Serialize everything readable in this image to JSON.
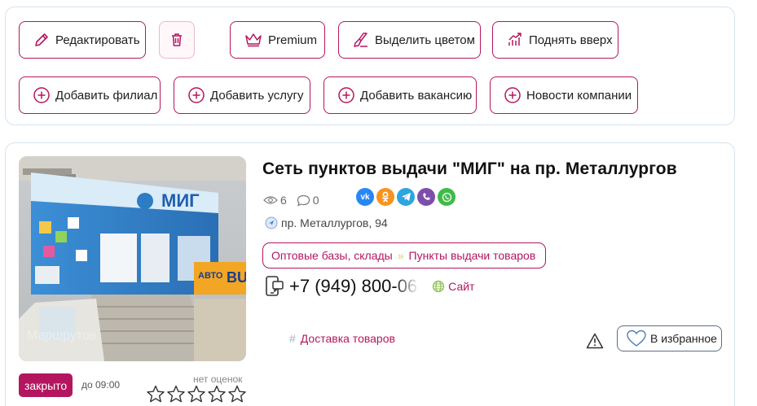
{
  "actions": {
    "edit": "Редактировать",
    "premium": "Premium",
    "highlight": "Выделить цветом",
    "raise": "Поднять вверх",
    "add_branch": "Добавить филиал",
    "add_service": "Добавить услугу",
    "add_vacancy": "Добавить вакансию",
    "company_news": "Новости компании"
  },
  "listing": {
    "title": "Сеть пунктов выдачи \"МИГ\" на пр. Металлургов",
    "views": "6",
    "comments": "0",
    "share_icons": [
      "vk-icon",
      "odnoklassniki-icon",
      "telegram-icon",
      "viber-icon",
      "whatsapp-icon"
    ],
    "address": "пр. Металлургов, 94",
    "category_parent": "Оптовые базы, склады",
    "category_child": "Пункты выдачи товаров",
    "phone": "+7 (949) 800-06",
    "site_label": "Сайт",
    "tag": "Доставка товаров",
    "favorite_label": "В избранное",
    "status": "закрыто",
    "status_until": "до 09:00",
    "rating_label": "нет оценок",
    "rating_stars": 0,
    "rating_max": 5
  },
  "colors": {
    "accent": "#b3165f",
    "border": "#d7e3ef",
    "vk": "#2787f5",
    "ok": "#f7931e",
    "telegram": "#2ca5e0",
    "viber": "#7d4eaa",
    "whatsapp": "#3fba4a"
  }
}
